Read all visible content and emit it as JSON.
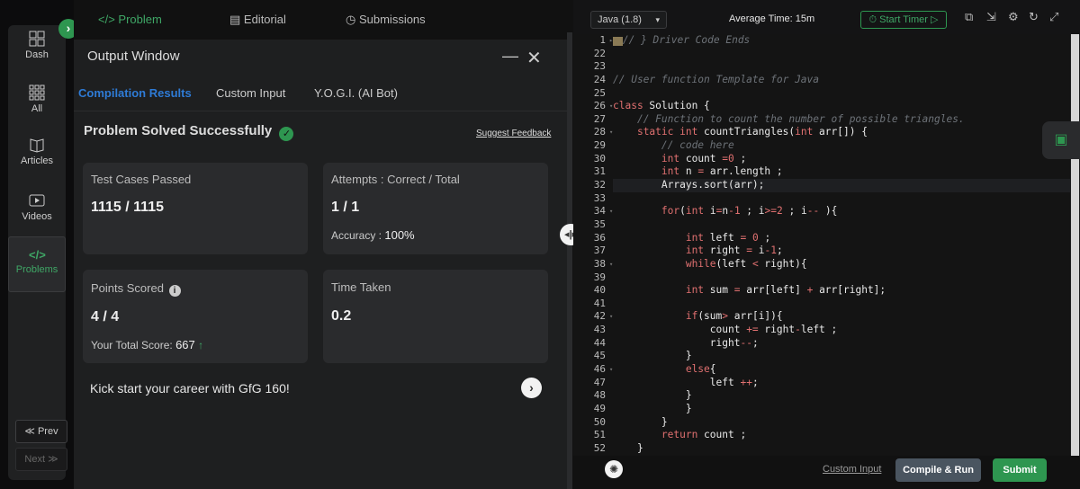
{
  "nav": {
    "items": [
      {
        "label": "Dash",
        "icon": "dashboard-icon"
      },
      {
        "label": "All",
        "icon": "grid-icon"
      },
      {
        "label": "Articles",
        "icon": "book-icon"
      },
      {
        "label": "Videos",
        "icon": "video-icon"
      },
      {
        "label": "Problems",
        "icon": "code-icon",
        "active": true
      }
    ],
    "prev_label": "≪ Prev",
    "next_label": "Next ≫"
  },
  "top_tabs": [
    {
      "label": "</> Problem",
      "active": true
    },
    {
      "label": "Editorial"
    },
    {
      "label": "Submissions"
    }
  ],
  "output": {
    "title": "Output Window",
    "min_glyph": "—",
    "close_glyph": "✕",
    "tabs": [
      {
        "label": "Compilation Results",
        "active": true
      },
      {
        "label": "Custom Input"
      },
      {
        "label": "Y.O.G.I. (AI Bot)"
      }
    ],
    "status": "Problem Solved Successfully",
    "suggest_feedback": "Suggest Feedback",
    "test_cases": {
      "label": "Test Cases Passed",
      "value": "1115 / 1115"
    },
    "attempts": {
      "label": "Attempts : Correct / Total",
      "value": "1 / 1",
      "accuracy_label": "Accuracy :",
      "accuracy_value": "100%"
    },
    "points": {
      "label": "Points Scored",
      "value": "4 / 4",
      "total_label": "Your Total Score:",
      "total_value": "667"
    },
    "time": {
      "label": "Time Taken",
      "value": "0.2"
    },
    "kick": "Kick start your career with GfG 160!"
  },
  "editor": {
    "language": "Java (1.8)",
    "avg_time": "Average Time: 15m",
    "timer_label": "Start Timer",
    "line_numbers": [
      "1",
      "22",
      "23",
      "24",
      "25",
      "26",
      "27",
      "28",
      "29",
      "30",
      "31",
      "32",
      "33",
      "34",
      "35",
      "36",
      "37",
      "38",
      "39",
      "40",
      "41",
      "42",
      "43",
      "44",
      "45",
      "46",
      "47",
      "48",
      "49",
      "50",
      "51",
      "52"
    ],
    "custom_input": "Custom Input",
    "compile_run": "Compile & Run",
    "submit": "Submit"
  },
  "colors": {
    "accent_green": "#2e9650",
    "tab_blue": "#2e7bd6",
    "keyword_red": "#e07070"
  }
}
